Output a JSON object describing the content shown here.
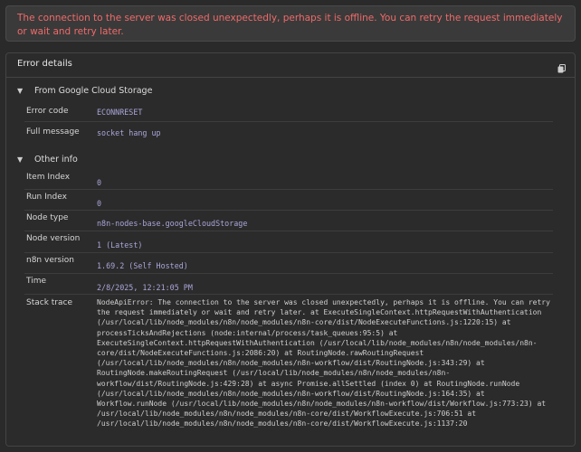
{
  "banner": {
    "message": "The connection to the server was closed unexpectedly, perhaps it is offline. You can retry the request immediately or wait and retry later."
  },
  "panel": {
    "title": "Error details",
    "copy_icon": "copy-icon"
  },
  "sections": {
    "gcs": {
      "title": "From Google Cloud Storage",
      "rows": [
        {
          "label": "Error code",
          "value": "ECONNRESET"
        },
        {
          "label": "Full message",
          "value": "socket hang up"
        }
      ]
    },
    "other": {
      "title": "Other info",
      "rows": [
        {
          "label": "Item Index",
          "value": "0"
        },
        {
          "label": "Run Index",
          "value": "0"
        },
        {
          "label": "Node type",
          "value": "n8n-nodes-base.googleCloudStorage"
        },
        {
          "label": "Node version",
          "value": "1 (Latest)"
        },
        {
          "label": "n8n version",
          "value": "1.69.2 (Self Hosted)"
        },
        {
          "label": "Time",
          "value": "2/8/2025, 12:21:05 PM"
        }
      ],
      "stack_label": "Stack trace",
      "stack_trace": "NodeApiError: The connection to the server was closed unexpectedly, perhaps it is offline. You can retry the request immediately or wait and retry later. at ExecuteSingleContext.httpRequestWithAuthentication (/usr/local/lib/node_modules/n8n/node_modules/n8n-core/dist/NodeExecuteFunctions.js:1220:15) at processTicksAndRejections (node:internal/process/task_queues:95:5) at ExecuteSingleContext.httpRequestWithAuthentication (/usr/local/lib/node_modules/n8n/node_modules/n8n-core/dist/NodeExecuteFunctions.js:2086:20) at RoutingNode.rawRoutingRequest (/usr/local/lib/node_modules/n8n/node_modules/n8n-workflow/dist/RoutingNode.js:343:29) at RoutingNode.makeRoutingRequest (/usr/local/lib/node_modules/n8n/node_modules/n8n-workflow/dist/RoutingNode.js:429:28) at async Promise.allSettled (index 0) at RoutingNode.runNode (/usr/local/lib/node_modules/n8n/node_modules/n8n-workflow/dist/RoutingNode.js:164:35) at Workflow.runNode (/usr/local/lib/node_modules/n8n/node_modules/n8n-workflow/dist/Workflow.js:773:23) at /usr/local/lib/node_modules/n8n/node_modules/n8n-core/dist/WorkflowExecute.js:706:51 at /usr/local/lib/node_modules/n8n/node_modules/n8n-core/dist/WorkflowExecute.js:1137:20"
    }
  }
}
